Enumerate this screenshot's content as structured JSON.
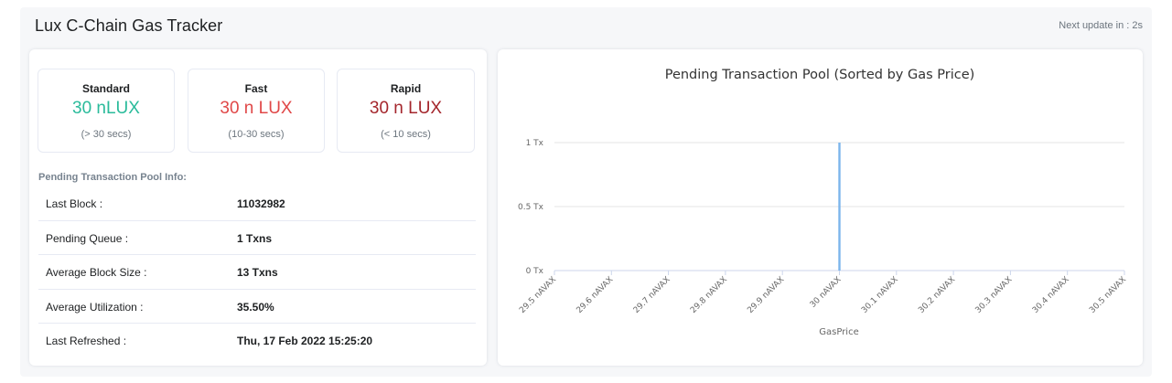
{
  "header": {
    "title": "Lux C-Chain Gas Tracker",
    "next_update": "Next update in : 2s"
  },
  "tiers": [
    {
      "name": "Standard",
      "price": "30 nLUX",
      "time": "(> 30 secs)",
      "color": "#2abb9b"
    },
    {
      "name": "Fast",
      "price": "30 n LUX",
      "time": "(10-30 secs)",
      "color": "#e04848"
    },
    {
      "name": "Rapid",
      "price": "30 n LUX",
      "time": "(< 10 secs)",
      "color": "#a4262c"
    }
  ],
  "pool_info": {
    "heading": "Pending Transaction Pool Info:",
    "rows": [
      {
        "label": "Last Block :",
        "value": "11032982"
      },
      {
        "label": "Pending Queue :",
        "value": "1 Txns"
      },
      {
        "label": "Average Block Size :",
        "value": "13 Txns"
      },
      {
        "label": "Average Utilization :",
        "value": "35.50%"
      },
      {
        "label": "Last Refreshed :",
        "value": "Thu, 17 Feb 2022 15:25:20"
      }
    ]
  },
  "chart_data": {
    "type": "bar",
    "title": "Pending Transaction Pool (Sorted by Gas Price)",
    "xlabel": "GasPrice",
    "ylabel": "",
    "categories": [
      "29.5 nAVAX",
      "29.6 nAVAX",
      "29.7 nAVAX",
      "29.8 nAVAX",
      "29.9 nAVAX",
      "30 nAVAX",
      "30.1 nAVAX",
      "30.2 nAVAX",
      "30.3 nAVAX",
      "30.4 nAVAX",
      "30.5 nAVAX"
    ],
    "values": [
      0,
      0,
      0,
      0,
      0,
      1,
      0,
      0,
      0,
      0,
      0
    ],
    "y_ticks": [
      {
        "value": 0,
        "label": "0 Tx"
      },
      {
        "value": 0.5,
        "label": "0.5 Tx"
      },
      {
        "value": 1,
        "label": "1 Tx"
      }
    ],
    "ylim": [
      0,
      1
    ],
    "grid": true,
    "bar_color": "#7cb5ec"
  }
}
